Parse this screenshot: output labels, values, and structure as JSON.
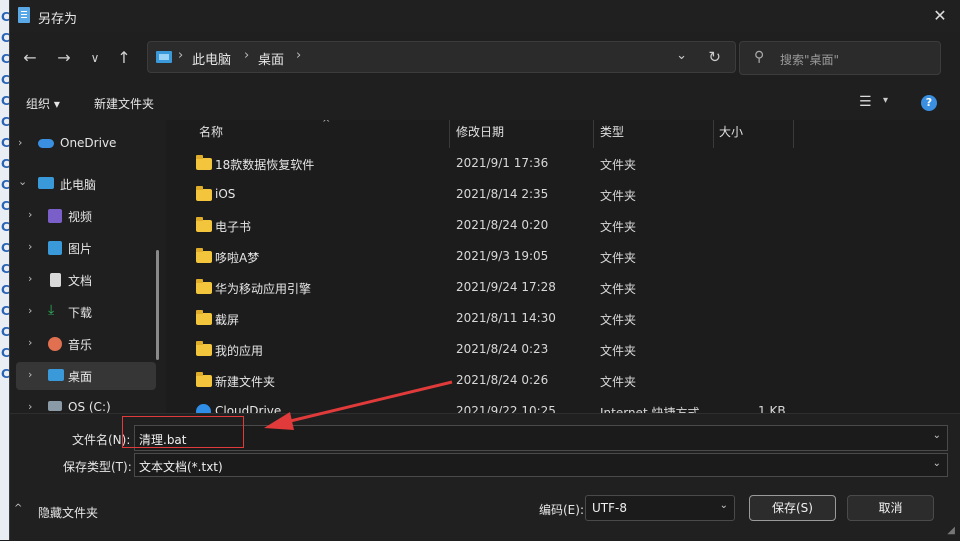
{
  "window": {
    "title": "另存为",
    "close_glyph": "✕"
  },
  "bg_strip_letters": [
    "C",
    "C",
    "C",
    "C",
    "C",
    "C",
    "C",
    "C",
    "C",
    "C",
    "C",
    "C",
    "C",
    "C",
    "C",
    "C",
    "C",
    "C"
  ],
  "nav": {
    "back": "←",
    "forward": "→",
    "recent": "∨",
    "up": "↑",
    "breadcrumbs": [
      "此电脑",
      "桌面"
    ],
    "crumb_sep": "›",
    "address_dropdown": "⌄",
    "refresh": "↻",
    "search_placeholder": "搜索\"桌面\"",
    "search_icon": "⚲"
  },
  "command_bar": {
    "organize": "组织 ▾",
    "new_folder": "新建文件夹",
    "view_icon": "☰",
    "view_dropdown": "▾",
    "help": "?"
  },
  "sidebar": {
    "items": [
      {
        "label": "OneDrive",
        "icon": "cloud-icon",
        "color": "#3a8fe0",
        "expanded": false
      },
      {
        "label": "此电脑",
        "icon": "computer-icon",
        "color": "#3a9ad9",
        "expanded": true
      },
      {
        "label": "视频",
        "icon": "video-icon",
        "color": "#7a5fc8",
        "expanded": false
      },
      {
        "label": "图片",
        "icon": "picture-icon",
        "color": "#3a9ad9",
        "expanded": false
      },
      {
        "label": "文档",
        "icon": "document-icon",
        "color": "#d9d9d9",
        "expanded": false
      },
      {
        "label": "下载",
        "icon": "download-icon",
        "color": "#2fae5a",
        "expanded": false
      },
      {
        "label": "音乐",
        "icon": "music-icon",
        "color": "#e07050",
        "expanded": false
      },
      {
        "label": "桌面",
        "icon": "desktop-icon",
        "color": "#3a9ad9",
        "expanded": false,
        "selected": true
      },
      {
        "label": "OS (C:)",
        "icon": "drive-icon",
        "color": "#9aa",
        "expanded": false
      }
    ]
  },
  "file_list": {
    "columns": [
      "名称",
      "修改日期",
      "类型",
      "大小"
    ],
    "sort_indicator": "^",
    "rows": [
      {
        "name": "18款数据恢复软件",
        "date": "2021/9/1 17:36",
        "type": "文件夹",
        "size": "",
        "icon": "folder-icon"
      },
      {
        "name": "iOS",
        "date": "2021/8/14 2:35",
        "type": "文件夹",
        "size": "",
        "icon": "folder-icon"
      },
      {
        "name": "电子书",
        "date": "2021/8/24 0:20",
        "type": "文件夹",
        "size": "",
        "icon": "folder-icon"
      },
      {
        "name": "哆啦A梦",
        "date": "2021/9/3 19:05",
        "type": "文件夹",
        "size": "",
        "icon": "folder-icon"
      },
      {
        "name": "华为移动应用引擎",
        "date": "2021/9/24 17:28",
        "type": "文件夹",
        "size": "",
        "icon": "folder-icon"
      },
      {
        "name": "截屏",
        "date": "2021/8/11 14:30",
        "type": "文件夹",
        "size": "",
        "icon": "folder-icon"
      },
      {
        "name": "我的应用",
        "date": "2021/8/24 0:23",
        "type": "文件夹",
        "size": "",
        "icon": "folder-icon"
      },
      {
        "name": "新建文件夹",
        "date": "2021/8/24 0:26",
        "type": "文件夹",
        "size": "",
        "icon": "folder-icon"
      },
      {
        "name": "CloudDrive",
        "date": "2021/9/22 10:25",
        "type": "Internet 快捷方式",
        "size": "1 KB",
        "icon": "cloud-shortcut-icon"
      }
    ]
  },
  "bottom": {
    "filename_label": "文件名(N):",
    "filename_value": "清理.bat",
    "filetype_label": "保存类型(T):",
    "filetype_value": "文本文档(*.txt)",
    "hide_folders": "隐藏文件夹",
    "encoding_label": "编码(E):",
    "encoding_value": "UTF-8",
    "save_button": "保存(S)",
    "cancel_button": "取消",
    "dropdown_glyph": "⌄",
    "hide_chevron": "^"
  },
  "annotation": {
    "color": "#e03a3a"
  }
}
